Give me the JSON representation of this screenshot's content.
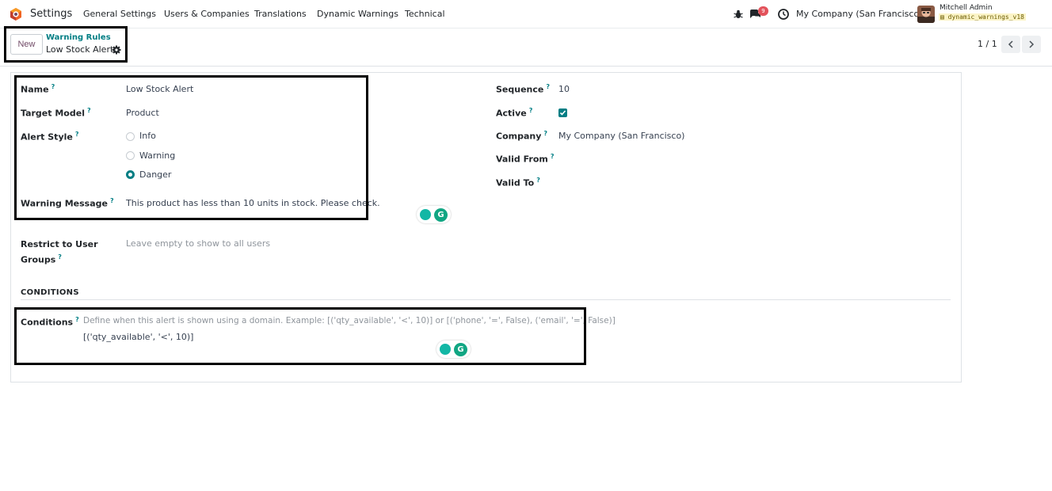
{
  "navbar": {
    "app_name": "Settings",
    "menus": [
      "General Settings",
      "Users & Companies",
      "Translations",
      "Dynamic Warnings",
      "Technical"
    ],
    "messages_badge": "9",
    "company": "My Company (San Francisco)",
    "user_name": "Mitchell Admin",
    "database": "dynamic_warnings_v18",
    "icons": [
      "bug-icon",
      "chat-icon",
      "clock-icon"
    ]
  },
  "control_panel": {
    "new_label": "New",
    "breadcrumb_parent": "Warning Rules",
    "breadcrumb_current": "Low Stock Alert",
    "pager": "1 / 1"
  },
  "form": {
    "name_label": "Name",
    "name_value": "Low Stock Alert",
    "target_model_label": "Target Model",
    "target_model_value": "Product",
    "alert_style_label": "Alert Style",
    "alert_style_options": [
      "Info",
      "Warning",
      "Danger"
    ],
    "alert_style_selected": "Danger",
    "warning_message_label": "Warning Message",
    "warning_message_value": "This product has less than 10 units in stock. Please check.",
    "restrict_label_line1": "Restrict to User",
    "restrict_label_line2": "Groups",
    "restrict_placeholder": "Leave empty to show to all users",
    "sequence_label": "Sequence",
    "sequence_value": "10",
    "active_label": "Active",
    "active_checked": true,
    "company_label": "Company",
    "company_value": "My Company (San Francisco)",
    "valid_from_label": "Valid From",
    "valid_to_label": "Valid To",
    "conditions_section": "CONDITIONS",
    "conditions_label": "Conditions",
    "conditions_help": "Define when this alert is shown using a domain. Example: [('qty_available', '<', 10)] or [('phone', '=', False), ('email', '=', False)]",
    "conditions_value": "[('qty_available', '<', 10)]",
    "help_mark": "?"
  },
  "extensions": {
    "grammarly_letter": "G"
  },
  "colors": {
    "accent": "#017e84",
    "brand": "#714b67",
    "badge": "#e3525b",
    "highlight_box": "#000000"
  }
}
